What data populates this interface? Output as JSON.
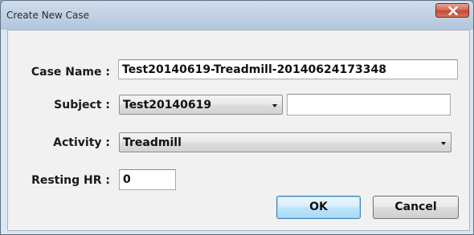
{
  "window": {
    "title": "Create New Case",
    "close_glyph": "✕"
  },
  "form": {
    "case_name": {
      "label": "Case Name :",
      "value": "Test20140619-Treadmill-20140624173348"
    },
    "subject": {
      "label": "Subject :",
      "selected": "Test20140619",
      "extra_value": ""
    },
    "activity": {
      "label": "Activity :",
      "selected": "Treadmill"
    },
    "resting_hr": {
      "label": "Resting HR :",
      "value": "0"
    }
  },
  "buttons": {
    "ok_label": "OK",
    "cancel_label": "Cancel"
  },
  "icons": {
    "close": "close-icon",
    "dropdown": "chevron-down-icon"
  },
  "colors": {
    "titlebar": "#bfd0e3",
    "close_button": "#c34a35",
    "default_button_border": "#3c7fb1",
    "dialog_background": "#f1f1f1"
  }
}
